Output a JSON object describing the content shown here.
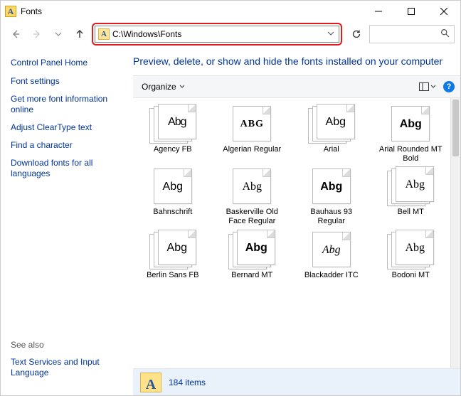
{
  "window": {
    "title": "Fonts"
  },
  "address": {
    "path": "C:\\Windows\\Fonts"
  },
  "sidebar": {
    "home": "Control Panel Home",
    "links": [
      "Font settings",
      "Get more font information online",
      "Adjust ClearType text",
      "Find a character",
      "Download fonts for all languages"
    ],
    "also_head": "See also",
    "also_links": [
      "Text Services and Input Language"
    ]
  },
  "main": {
    "heading": "Preview, delete, or show and hide the fonts installed on your computer"
  },
  "toolbar": {
    "organize": "Organize"
  },
  "fonts": [
    {
      "name": "Agency FB",
      "sample": "Abg",
      "style": "s-agency",
      "multi": true
    },
    {
      "name": "Algerian Regular",
      "sample": "ABG",
      "style": "s-algerian",
      "multi": false
    },
    {
      "name": "Arial",
      "sample": "Abg",
      "style": "s-arial",
      "multi": true
    },
    {
      "name": "Arial Rounded MT Bold",
      "sample": "Abg",
      "style": "s-arialround",
      "multi": false
    },
    {
      "name": "Bahnschrift",
      "sample": "Abg",
      "style": "s-bahn",
      "multi": false
    },
    {
      "name": "Baskerville Old Face Regular",
      "sample": "Abg",
      "style": "s-baskerville",
      "multi": false
    },
    {
      "name": "Bauhaus 93 Regular",
      "sample": "Abg",
      "style": "s-bauhaus",
      "multi": false
    },
    {
      "name": "Bell MT",
      "sample": "Abg",
      "style": "s-bell",
      "multi": true
    },
    {
      "name": "Berlin Sans FB",
      "sample": "Abg",
      "style": "s-berlin",
      "multi": true
    },
    {
      "name": "Bernard MT",
      "sample": "Abg",
      "style": "s-bernard",
      "multi": true
    },
    {
      "name": "Blackadder ITC",
      "sample": "Abg",
      "style": "s-blackadder",
      "multi": false
    },
    {
      "name": "Bodoni MT",
      "sample": "Abg",
      "style": "s-bodoni",
      "multi": true
    }
  ],
  "status": {
    "count": "184 items"
  }
}
